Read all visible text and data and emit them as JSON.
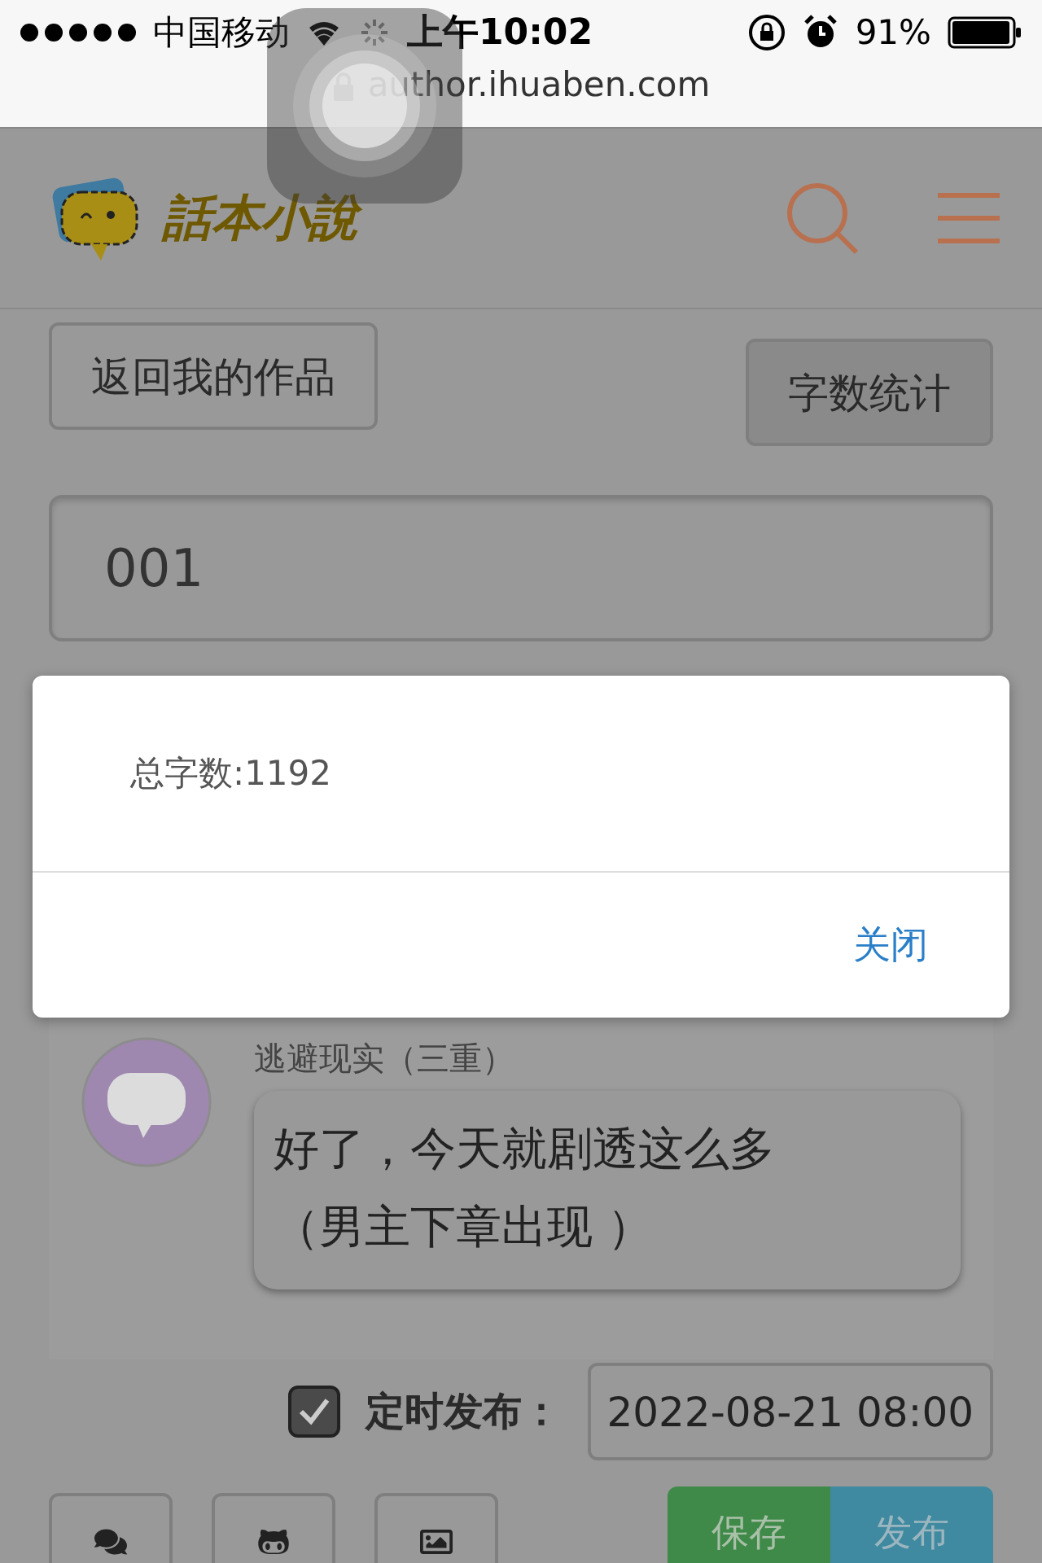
{
  "status_bar": {
    "carrier": "中国移动",
    "time": "上午10:02",
    "battery": "91%"
  },
  "address_bar": {
    "url": "author.ihuaben.com"
  },
  "header": {
    "logo_text": "話本小說"
  },
  "back_button": "返回我的作品",
  "word_count_button": "字数统计",
  "title_field": {
    "value": "001"
  },
  "dialog": {
    "message": "总字数:1192",
    "close_button": "关闭"
  },
  "chat": {
    "author": "逃避现实（三重）",
    "message_lines": [
      "好了，今天就剧透这么多",
      "（男主下章出现 ）"
    ]
  },
  "schedule": {
    "checked": true,
    "label": "定时发布：",
    "value": "2022-08-21 08:00"
  },
  "save_button": "保存",
  "publish_button": "发布"
}
